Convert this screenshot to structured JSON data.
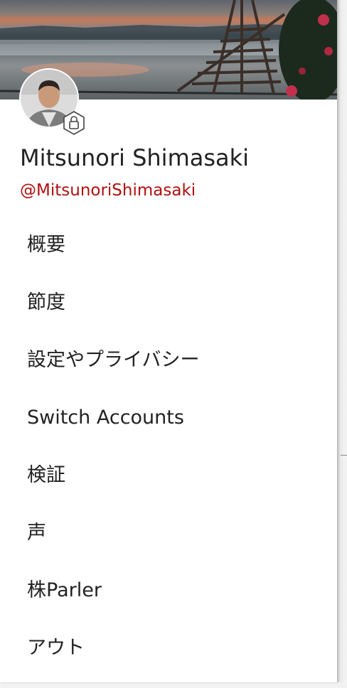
{
  "profile": {
    "name": "Mitsunori Shimasaki",
    "handle": "@MitsunoriShimasaki",
    "avatar_icon": "user-photo",
    "badge_icon": "lock-icon",
    "cover": "lake-sunrise-cover-photo"
  },
  "menu": {
    "items": [
      {
        "label": "概要"
      },
      {
        "label": "節度"
      },
      {
        "label": "設定やプライバシー"
      },
      {
        "label": "Switch Accounts"
      },
      {
        "label": "検証"
      },
      {
        "label": "声"
      },
      {
        "label": "株Parler"
      },
      {
        "label": "アウト"
      }
    ]
  },
  "colors": {
    "handle": "#b01010",
    "text": "#222222",
    "drawer": "#ffffff"
  }
}
